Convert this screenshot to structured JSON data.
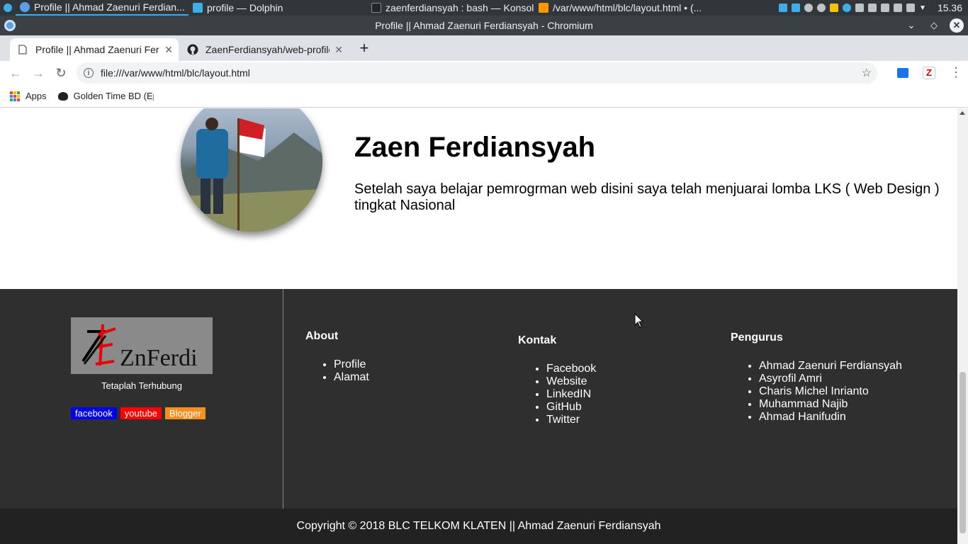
{
  "taskbar": {
    "tasks": [
      {
        "label": "Profile || Ahmad Zaenuri Ferdian..."
      },
      {
        "label": "profile — Dolphin"
      },
      {
        "label": "zaenferdiansyah : bash — Konsole"
      },
      {
        "label": "/var/www/html/blc/layout.html • (..."
      }
    ],
    "clock": "15.36"
  },
  "window": {
    "title": "Profile || Ahmad Zaenuri Ferdiansyah - Chromium"
  },
  "browser": {
    "tabs": [
      {
        "label": "Profile || Ahmad Zaenuri Ferdiansyah"
      },
      {
        "label": "ZaenFerdiansyah/web-profile"
      }
    ],
    "url": "file:///var/www/html/blc/layout.html",
    "bookmarks": [
      {
        "label": "Apps"
      },
      {
        "label": "Golden Time BD (Ep"
      }
    ]
  },
  "profile": {
    "name": "Zaen Ferdiansyah",
    "bio": "Setelah saya belajar pemrogrman web disini saya telah menjuarai lomba LKS ( Web Design ) tingkat Nasional"
  },
  "footer": {
    "logo_text": "ZnFerdi",
    "tagline": "Tetaplah Terhubung",
    "social": [
      {
        "label": "facebook",
        "color": "#0000ee"
      },
      {
        "label": "youtube",
        "color": "#ff0000"
      },
      {
        "label": "Blogger",
        "color": "#f4901e"
      }
    ],
    "about": {
      "heading": "About",
      "items": [
        "Profile",
        "Alamat"
      ]
    },
    "kontak": {
      "heading": "Kontak",
      "items": [
        "Facebook",
        "Website",
        "LinkedIN",
        "GitHub",
        "Twitter"
      ]
    },
    "pengurus": {
      "heading": "Pengurus",
      "items": [
        "Ahmad Zaenuri Ferdiansyah",
        "Asyrofil Amri",
        "Charis Michel Inrianto",
        "Muhammad Najib",
        "Ahmad Hanifudin"
      ]
    },
    "copyright": "Copyright © 2018 BLC TELKOM KLATEN || Ahmad Zaenuri Ferdiansyah"
  }
}
